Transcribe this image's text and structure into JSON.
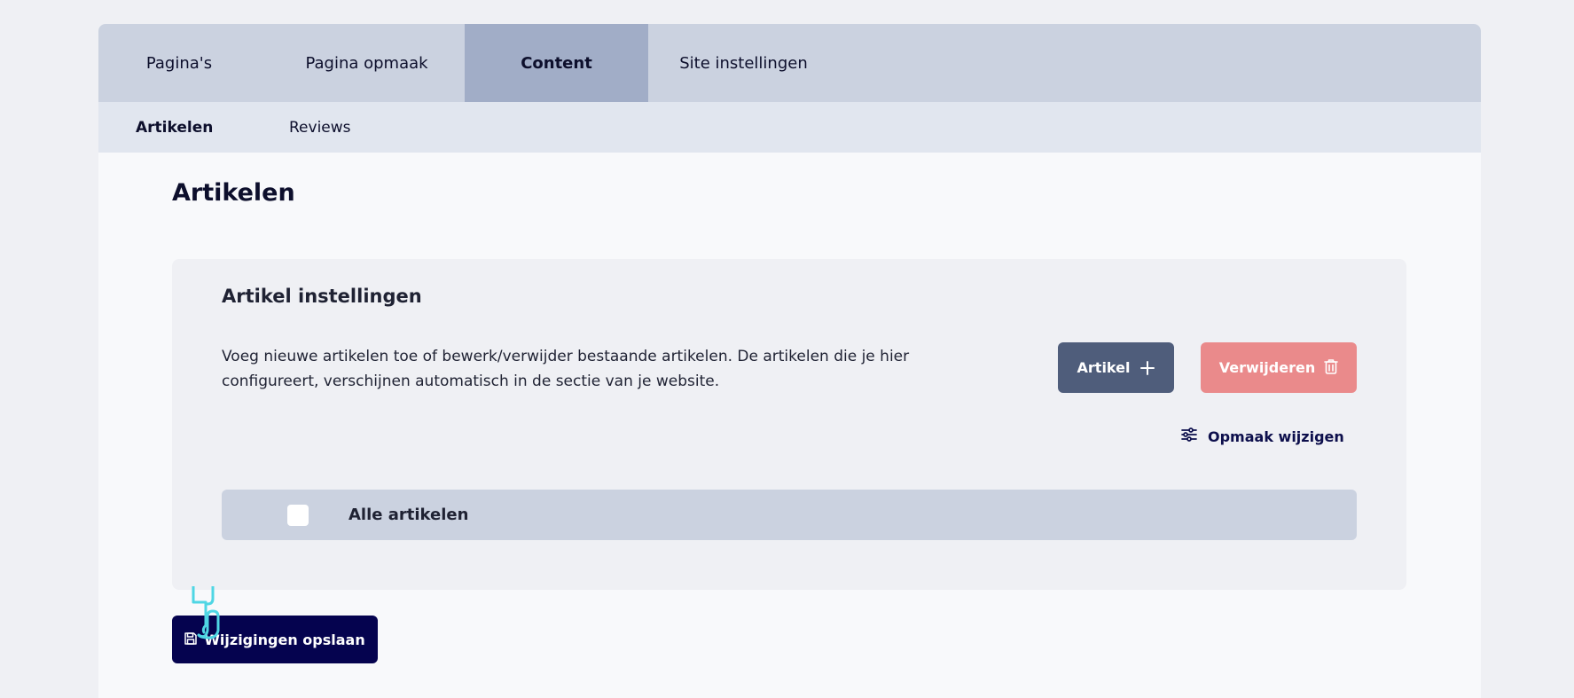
{
  "top_tabs": [
    {
      "label": "Pagina's"
    },
    {
      "label": "Pagina opmaak"
    },
    {
      "label": "Content",
      "active": true
    },
    {
      "label": "Site instellingen"
    }
  ],
  "sub_tabs": [
    {
      "label": "Artikelen",
      "active": true
    },
    {
      "label": "Reviews"
    }
  ],
  "page": {
    "title": "Artikelen"
  },
  "card": {
    "title": "Artikel instellingen",
    "description": "Voeg nieuwe artikelen toe of bewerk/verwijder bestaande artikelen. De artikelen die je hier configureert, verschijnen automatisch in de sectie van je website.",
    "add_button_label": "Artikel",
    "add_button_icon": "plus-icon",
    "delete_button_label": "Verwijderen",
    "delete_button_icon": "trash-icon",
    "layout_link_label": "Opmaak wijzigen",
    "layout_link_icon": "sliders-icon",
    "list_header_label": "Alle artikelen",
    "select_all_checked": false
  },
  "save_button": {
    "label": "Wijzigingen opslaan",
    "icon": "save-icon"
  },
  "colors": {
    "primary_dark": "#05034f",
    "add_button": "#4f5d7b",
    "delete_button": "#ea8a8b",
    "tab_bar": "#cbd2e0",
    "tab_active": "#a1adc7",
    "subtab_bar": "#e1e6ef",
    "cursor": "#4fd6e4"
  }
}
